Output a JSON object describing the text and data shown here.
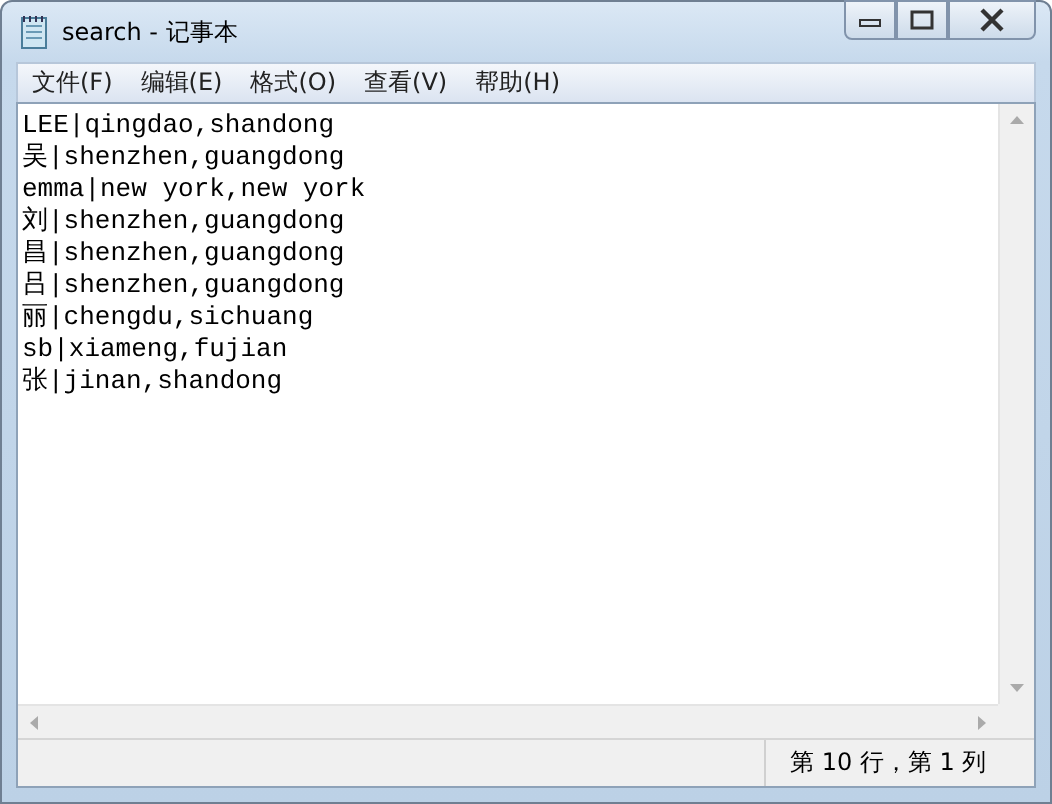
{
  "window": {
    "title": "search - 记事本"
  },
  "menu": [
    "文件(F)",
    "编辑(E)",
    "格式(O)",
    "查看(V)",
    "帮助(H)"
  ],
  "lines": [
    "LEE|qingdao,shandong",
    "吴|shenzhen,guangdong",
    "emma|new york,new york",
    "刘|shenzhen,guangdong",
    "昌|shenzhen,guangdong",
    "吕|shenzhen,guangdong",
    "丽|chengdu,sichuang",
    "sb|xiameng,fujian",
    "张|jinan,shandong"
  ],
  "status_bar": {
    "position": "第 10 行，第 1 列"
  }
}
